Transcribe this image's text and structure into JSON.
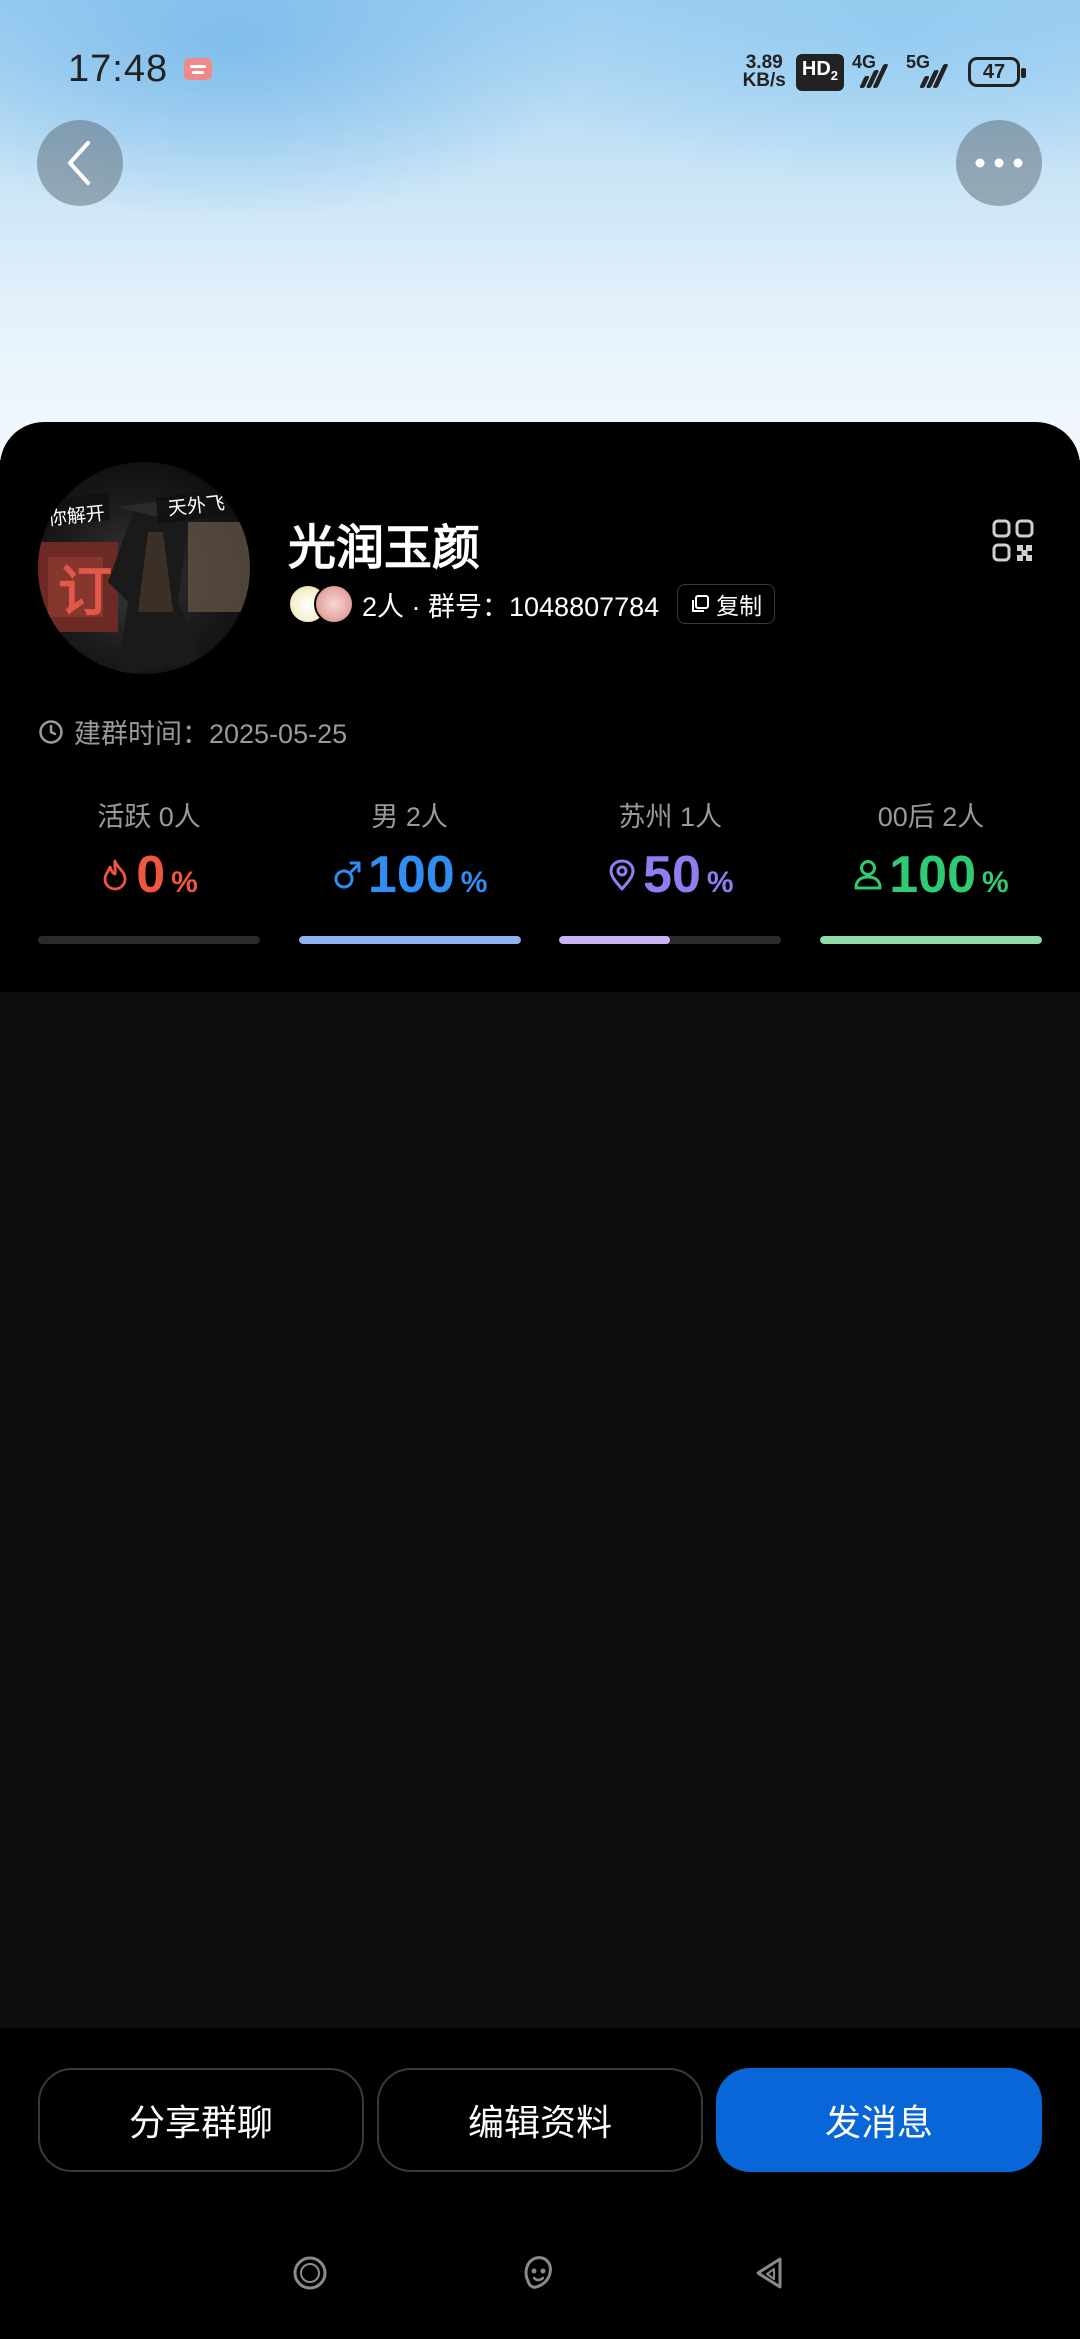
{
  "status_bar": {
    "time": "17:48",
    "net_speed_value": "3.89",
    "net_speed_unit": "KB/s",
    "hd": "HD",
    "hd_sub": "2",
    "signal1": "4G",
    "signal2": "5G",
    "battery": "47"
  },
  "header": {
    "back_icon": "chevron-left-icon",
    "more_icon": "more-dots-icon"
  },
  "group": {
    "name": "光润玉颜",
    "avatar_caption_left": "你解开",
    "avatar_caption_right": "天外飞",
    "member_summary": "2人 · 群号：1048807784",
    "copy_label": "复制",
    "created_label": "建群时间：2025-05-25"
  },
  "stats": [
    {
      "label": "活跃 0人",
      "value": "0",
      "unit": "%",
      "icon": "flame-icon",
      "color": "#f0563f",
      "fill": 0.0,
      "bar_color": "#f0563f"
    },
    {
      "label": "男 2人",
      "value": "100",
      "unit": "%",
      "icon": "male-icon",
      "color": "#2f8ef0",
      "fill": 1.0,
      "bar_color": "#8fb3ee"
    },
    {
      "label": "苏州 1人",
      "value": "50",
      "unit": "%",
      "icon": "location-pin-icon",
      "color": "#8f7ef0",
      "fill": 0.5,
      "bar_color": "#c7b6f2"
    },
    {
      "label": "00后 2人",
      "value": "100",
      "unit": "%",
      "icon": "person-icon",
      "color": "#2fca74",
      "fill": 1.0,
      "bar_color": "#8fdca8"
    }
  ],
  "actions": {
    "share": "分享群聊",
    "edit": "编辑资料",
    "send": "发消息"
  },
  "nav": {
    "left_icon": "home-circle-icon",
    "center_icon": "assistant-icon",
    "right_icon": "back-triangle-icon"
  }
}
